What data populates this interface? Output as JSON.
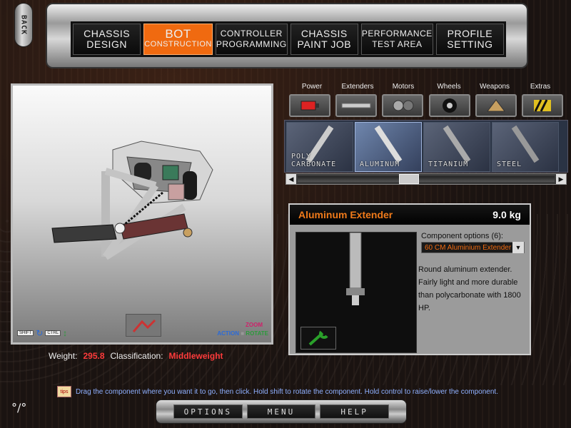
{
  "nav": {
    "back": "BACK",
    "tabs": [
      {
        "l1": "CHASSIS",
        "l2": "DESIGN"
      },
      {
        "l1": "BOT",
        "l2": "CONSTRUCTION"
      },
      {
        "l1": "CONTROLLER",
        "l2": "PROGRAMMING"
      },
      {
        "l1": "CHASSIS",
        "l2": "PAINT JOB"
      },
      {
        "l1": "PERFORMANCE",
        "l2": "TEST AREA"
      },
      {
        "l1": "PROFILE",
        "l2": "SETTING"
      }
    ],
    "active_tab": "BOT CONSTRUCTION"
  },
  "viewport": {
    "shift_key": "SHIFT",
    "ctrl_key": "CTRL",
    "action_label": "ACTION",
    "zoom_label": "ZOOM",
    "rotate_label": "ROTATE"
  },
  "stats": {
    "weight_label": "Weight:",
    "weight_value": "295.8",
    "class_label": "Classification:",
    "class_value": "Middleweight"
  },
  "categories": [
    "Power",
    "Extenders",
    "Motors",
    "Wheels",
    "Weapons",
    "Extras"
  ],
  "items": [
    {
      "label": "POLY CARBONATE"
    },
    {
      "label": "ALUMINUM"
    },
    {
      "label": "TITANIUM"
    },
    {
      "label": "STEEL"
    }
  ],
  "detail": {
    "title": "Aluminum Extender",
    "weight": "9.0 kg",
    "options_label": "Component options (6):",
    "selected_option": "60 CM Aluminium Extender",
    "description": "Round aluminum extender. Fairly light and more durable than polycarbonate with 1800 HP."
  },
  "tip": {
    "icon_text": "tips",
    "text": "Drag the component where you want it to go, then click. Hold shift to rotate the component. Hold control to raise/lower the component."
  },
  "bottom": {
    "options": "OPTIONS",
    "menu": "MENU",
    "help": "HELP"
  },
  "colors": {
    "accent": "#f06a10",
    "highlight_red": "#ff3b3b",
    "tip_blue": "#8fb0ff"
  }
}
